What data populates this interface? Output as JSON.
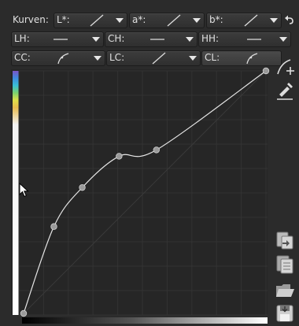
{
  "panel": {
    "title": "Kurven:"
  },
  "row1": [
    {
      "label": "L*:"
    },
    {
      "label": "a*:"
    },
    {
      "label": "b*:"
    }
  ],
  "row2": [
    {
      "label": "LH:"
    },
    {
      "label": "CH:"
    },
    {
      "label": "HH:"
    }
  ],
  "row3": [
    {
      "label": "CC:"
    },
    {
      "label": "LC:"
    },
    {
      "label": "CL:"
    }
  ],
  "curve": {
    "control_points": [
      [
        0.0,
        0.0
      ],
      [
        0.125,
        0.358
      ],
      [
        0.242,
        0.519
      ],
      [
        0.394,
        0.648
      ],
      [
        0.548,
        0.674
      ],
      [
        1.0,
        1.0
      ]
    ]
  },
  "colors": {
    "background": "#2b2b2b",
    "plot": "#262626",
    "curve": "#e6e6e6",
    "grid": "#333333"
  },
  "icons": [
    "reset-icon",
    "curve-edit-icon",
    "picker-icon",
    "copy-icon",
    "paste-icon",
    "open-icon",
    "save-icon"
  ]
}
